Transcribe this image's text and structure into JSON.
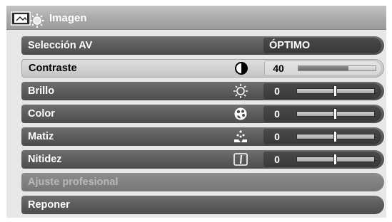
{
  "menu": {
    "title": "Imagen",
    "title_icon": "picture-settings-icon",
    "rows": [
      {
        "id": "seleccion-av",
        "label": "Selección AV",
        "value": "ÓPTIMO",
        "kind": "option",
        "state": "normal"
      },
      {
        "id": "contraste",
        "label": "Contraste",
        "icon": "contrast-icon",
        "value": "40",
        "level": 40,
        "kind": "slider",
        "scale": "0..40",
        "state": "active"
      },
      {
        "id": "brillo",
        "label": "Brillo",
        "icon": "brightness-sun-icon",
        "value": "0",
        "level": 0,
        "kind": "slider",
        "scale": "-30..30",
        "state": "normal"
      },
      {
        "id": "color",
        "label": "Color",
        "icon": "color-palette-icon",
        "value": "0",
        "level": 0,
        "kind": "slider",
        "scale": "-30..30",
        "state": "normal"
      },
      {
        "id": "matiz",
        "label": "Matiz",
        "icon": "tint-icon",
        "value": "0",
        "level": 0,
        "kind": "slider",
        "scale": "-30..30",
        "state": "normal"
      },
      {
        "id": "nitidez",
        "label": "Nitidez",
        "icon": "sharpness-icon",
        "value": "0",
        "level": 0,
        "kind": "slider",
        "scale": "-10..10",
        "state": "normal"
      },
      {
        "id": "ajuste-profesional",
        "label": "Ajuste profesional",
        "kind": "submenu",
        "state": "disabled"
      },
      {
        "id": "reponer",
        "label": "Reponer",
        "kind": "action",
        "state": "normal"
      }
    ]
  },
  "colors": {
    "row_normal": "#5a5a5a",
    "row_active": "#cfcfcf",
    "row_disabled": "#7f7f7f",
    "value_box": "#393939",
    "header": "#a9a9a9",
    "panel": "#e7e7e7"
  }
}
